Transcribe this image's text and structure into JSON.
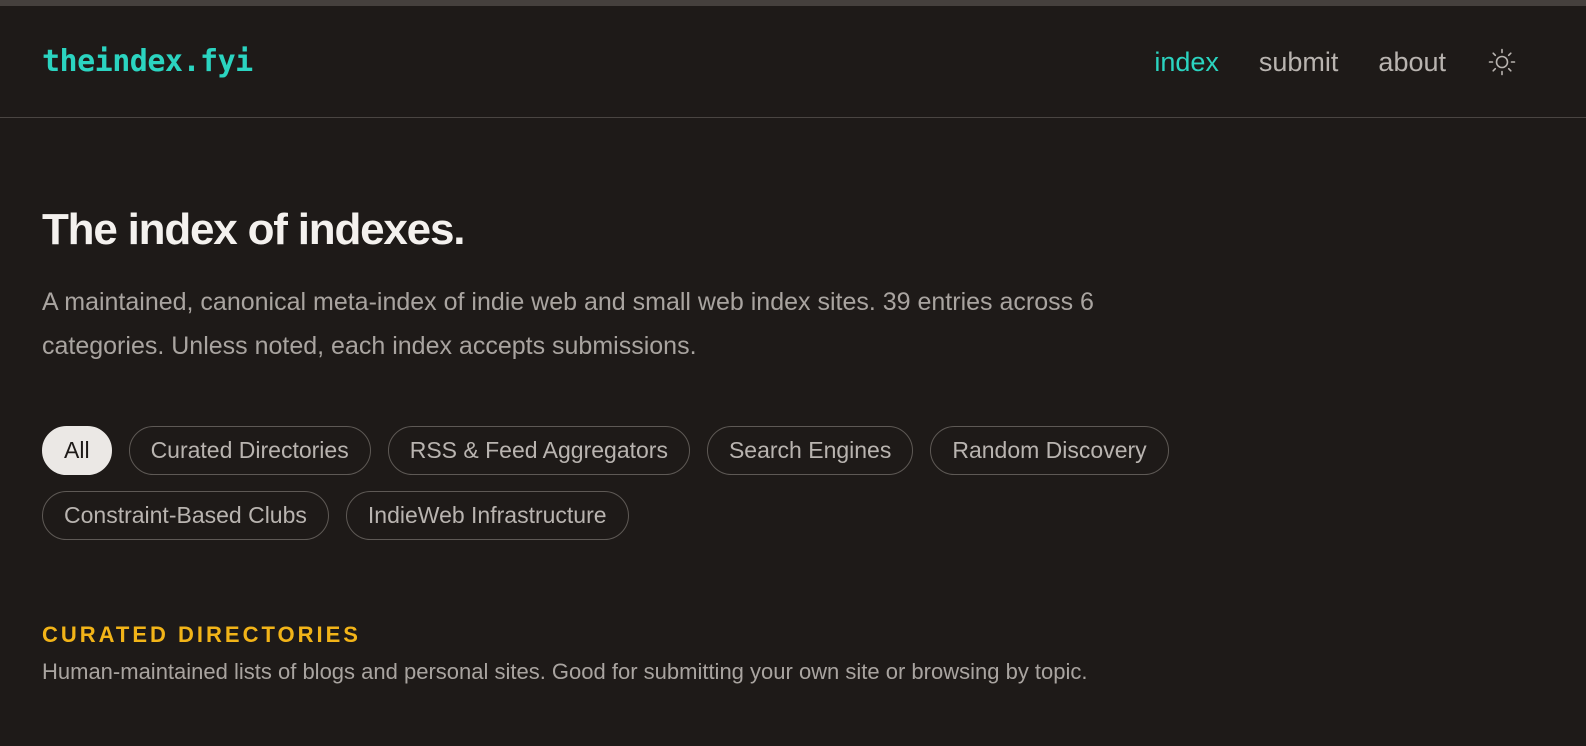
{
  "site": {
    "logo": "theindex.fyi"
  },
  "nav": {
    "items": [
      {
        "label": "index",
        "active": true
      },
      {
        "label": "submit",
        "active": false
      },
      {
        "label": "about",
        "active": false
      }
    ],
    "theme_icon": "sun-icon"
  },
  "hero": {
    "title": "The index of indexes.",
    "intro": "A maintained, canonical meta-index of indie web and small web index sites. 39 entries across 6 categories. Unless noted, each index accepts submissions."
  },
  "filters": {
    "selected": "All",
    "row1": [
      "All",
      "Curated Directories",
      "RSS & Feed Aggregators",
      "Search Engines",
      "Random Discovery"
    ],
    "row2": [
      "Constraint-Based Clubs",
      "IndieWeb Infrastructure"
    ]
  },
  "section": {
    "title": "CURATED DIRECTORIES",
    "description": "Human-maintained lists of blogs and personal sites. Good for submitting your own site or browsing by topic."
  },
  "colors": {
    "background": "#1e1a18",
    "accent": "#2bd4c0",
    "section_heading": "#f2b418",
    "chip_selected_bg": "#ebe8e5"
  }
}
